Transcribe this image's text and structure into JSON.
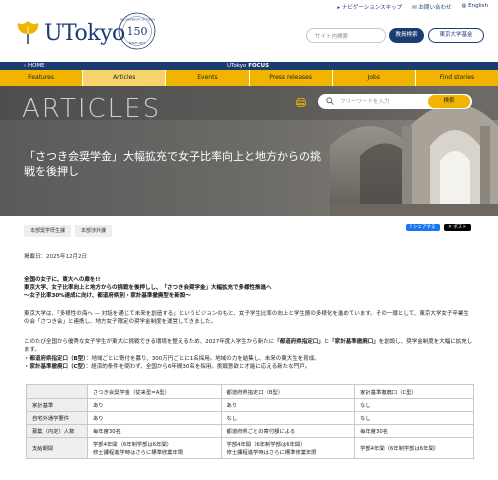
{
  "header": {
    "logo_text": "UTokyo",
    "badge": {
      "number": "150",
      "arc_text": "THE UNIVERSITY OF TOKYO",
      "since": "SINCE 1877"
    },
    "skip_links": [
      "ナビゲーションスキップ",
      "お問い合わせ",
      "English"
    ],
    "search_placeholder": "サイト内検索",
    "search_button": "教員検索",
    "fund_button": "東京大学基金"
  },
  "crumbbar": {
    "home": "HOME",
    "focus_prefix": "UTokyo",
    "focus_bold": "FOCUS"
  },
  "nav": [
    {
      "label": "Features",
      "active": false
    },
    {
      "label": "Articles",
      "active": true
    },
    {
      "label": "Events",
      "active": false
    },
    {
      "label": "Press releases",
      "active": false
    },
    {
      "label": "Jobs",
      "active": false
    },
    {
      "label": "Find stories",
      "active": false
    }
  ],
  "hero": {
    "section_title": "ARTICLES",
    "keyword_placeholder": "フリーワードを入力",
    "keyword_button": "検索",
    "heading": "「さつき会奨学金」大幅拡充で女子比率向上と地方からの挑戦を後押し"
  },
  "tags": [
    "本部奨学厚生課",
    "本部渉外課"
  ],
  "share": {
    "facebook": "シェアする",
    "x": "ポスト"
  },
  "date": "掲載日：2025年12月2日",
  "lead": [
    "全国の女子に、東大への扉を!!",
    "東京大学、女子比率向上と地方からの挑戦を後押しし、「さつき会奨学金」大幅拡充で多様性推進へ",
    "～女子比率30%達成に向け、都道府県別・家計基準撤廃型を新設～"
  ],
  "paragraphs": {
    "p1": "東京大学は、「多様性の海へ — 対話を通じて未来を創造する」というビジョンのもと、女子学生比率の向上と学生層の多様化を進めています。その一環として、東京大学女子卒業生の会「さつき会」と連携し、地方女子限定の奨学金制度を運営してきました。",
    "p2_pre": "このたび全国から優秀な女子学生が東大に挑戦できる環境を整えるため、2027年度入学生から新たに",
    "p2_b1": "「都道府県指定口」",
    "p2_mid": "と",
    "p2_b2": "「家計基準撤廃口」",
    "p2_post": "を創設し、奨学金制度を大幅に拡充します。"
  },
  "bullets": [
    {
      "bold": "・都道府県指定口（B型）",
      "text": "：地域ごとに寄付を募り、300万円ごとに1名採用。地域の力を結集し、未来の東大生を育成。"
    },
    {
      "bold": "・家計基準撤廃口（C型）",
      "text": "：経済的条件を問わず、全国から6年間30名を採用。挑戦意欲と才能に応える新たな門戸。"
    }
  ],
  "table": {
    "headers": [
      "",
      "さつき会奨学金（従来型=A型）",
      "都道府県指定口（B型）",
      "家計基準撤廃口（C型）"
    ],
    "rows": [
      [
        "家計基準",
        "あり",
        "あり",
        "なし"
      ],
      [
        "自宅外通学要件",
        "あり",
        "なし",
        "なし"
      ],
      [
        "募集（内定）人数",
        "毎年度30名",
        "都道府県ごとの寄付額による",
        "毎年度30名"
      ],
      [
        "支給期間",
        "学部4年間（6年制学部は6年間）\n修士課程進学時はさらに標準修業年限",
        "学部4年間（6年制学部は6年間）\n修士課程進学時はさらに標準修業年限",
        "学部4年間（6年制学部は6年間）"
      ]
    ]
  },
  "colors": {
    "navy": "#1b3c73",
    "gold": "#f1b400",
    "gold_active": "#f7d46b"
  }
}
